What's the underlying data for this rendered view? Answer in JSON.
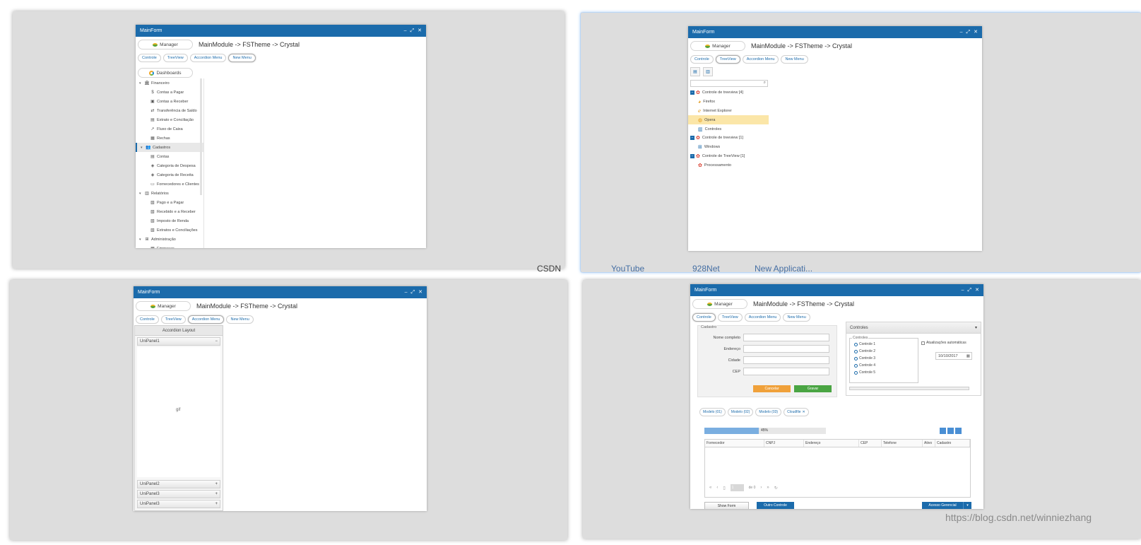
{
  "common": {
    "window_title": "MainForm",
    "manager_label": "Manager",
    "path": "MainModule -> FSTheme -> Crystal",
    "tabs": [
      "Controle",
      "TreeView",
      "Accordion Menu",
      "New Menu"
    ],
    "titlebar_icons": [
      "‒",
      "⤢",
      "✕"
    ]
  },
  "pane1": {
    "dashboards_label": "Dashboards",
    "tree": [
      {
        "level": 0,
        "label": "Financeiro",
        "icon": "bank-icon",
        "glyph": "🏛"
      },
      {
        "level": 1,
        "label": "Contas a Pagar",
        "icon": "dollar-icon",
        "glyph": "$"
      },
      {
        "level": 1,
        "label": "Contas a Receber",
        "icon": "money-icon",
        "glyph": "▣"
      },
      {
        "level": 1,
        "label": "Transferência de Saldo",
        "icon": "transfer-icon",
        "glyph": "⇄"
      },
      {
        "level": 1,
        "label": "Extrato e Conciliação",
        "icon": "card-icon",
        "glyph": "▤"
      },
      {
        "level": 1,
        "label": "Fluxo de Caixa",
        "icon": "chart-line-icon",
        "glyph": "↗"
      },
      {
        "level": 1,
        "label": "Rechas",
        "icon": "file-icon",
        "glyph": "▦"
      },
      {
        "level": 0,
        "label": "Cadastros",
        "icon": "users-icon",
        "glyph": "👥",
        "highlight": true
      },
      {
        "level": 1,
        "label": "Contas",
        "icon": "card-icon",
        "glyph": "▤"
      },
      {
        "level": 1,
        "label": "Categoria de Despesa",
        "icon": "tag-icon",
        "glyph": "◈"
      },
      {
        "level": 1,
        "label": "Categoria de Receita",
        "icon": "tag-icon",
        "glyph": "◈"
      },
      {
        "level": 1,
        "label": "Fornecedores e Clientes",
        "icon": "id-card-icon",
        "glyph": "▭"
      },
      {
        "level": 0,
        "label": "Relatórios",
        "icon": "report-icon",
        "glyph": "▥"
      },
      {
        "level": 1,
        "label": "Pago e a Pagar",
        "icon": "doc-icon",
        "glyph": "▧"
      },
      {
        "level": 1,
        "label": "Recebido e a Receber",
        "icon": "doc-icon",
        "glyph": "▧"
      },
      {
        "level": 1,
        "label": "Imposto de Renda",
        "icon": "doc-icon",
        "glyph": "▧"
      },
      {
        "level": 1,
        "label": "Extratos e Conciliações",
        "icon": "doc-icon",
        "glyph": "▧"
      },
      {
        "level": 0,
        "label": "Administração",
        "icon": "sitemap-icon",
        "glyph": "⊞"
      },
      {
        "level": 1,
        "label": "Empresas",
        "icon": "building-icon",
        "glyph": "▦"
      }
    ]
  },
  "pane2": {
    "selected_tab": 1,
    "tree": [
      {
        "level": 0,
        "label": "Controle de treeview [4]",
        "icon": "red-group-icon"
      },
      {
        "level": 1,
        "label": "Firefox",
        "icon": "firefox-icon"
      },
      {
        "level": 1,
        "label": "Internet Explorer",
        "icon": "ie-icon"
      },
      {
        "level": 1,
        "label": "Opera",
        "icon": "opera-icon",
        "selected": true
      },
      {
        "level": 1,
        "label": "Controles",
        "icon": "controls-icon"
      },
      {
        "level": 0,
        "label": "Controle de treeview [1]",
        "icon": "red-group-icon"
      },
      {
        "level": 1,
        "label": "Windows",
        "icon": "windows-icon"
      },
      {
        "level": 0,
        "label": "Controle de TreeView [1]",
        "icon": "red-group-icon"
      },
      {
        "level": 1,
        "label": "Processamento",
        "icon": "gear-icon"
      }
    ]
  },
  "pane3": {
    "selected_tab": 2,
    "accordion_title": "Accordion Layout",
    "panels": [
      "UniPanel1",
      "UniPanel2",
      "UniPanel3",
      "UniPanel3"
    ],
    "body_text": "gif"
  },
  "pane4": {
    "selected_tab": 0,
    "cadastro_legend": "Cadastro",
    "fields": [
      "Nome completo",
      "Endereço",
      "Cidade",
      "CEP"
    ],
    "btn_cancel": "Cancelar",
    "btn_save": "Gravar",
    "controles_title": "Controles",
    "controles_legend": "Controles",
    "radios": [
      "Controle 1",
      "Controle 2",
      "Controle 3",
      "Controle 4",
      "Controle 5"
    ],
    "checkbox_label": "Atualizações automáticas",
    "date_value": "10/10/2017",
    "sub_tabs": [
      "Modelo (01)",
      "Modelo (02)",
      "Modelo (03)",
      "Cloudfile"
    ],
    "progress_percent": 45,
    "progress_label": "45%",
    "grid_columns": [
      "Fornecedor",
      "CNPJ",
      "Endereço",
      "CEP",
      "Telefone",
      "Ativo",
      "Cadastro"
    ],
    "pager_page": "1",
    "pager_of": "de 0",
    "btn_show_form": "Show Form",
    "btn_outro": "Outro Controle",
    "btn_acesso": "Acesso Gerencial"
  },
  "bookmarks": [
    "CSDN",
    "YouTube",
    "928Net",
    "New Applicati..."
  ],
  "watermark": "https://blog.csdn.net/winniezhang",
  "colors": {
    "titlebar": "#1b6bab",
    "accent": "#1b6bab",
    "orange": "#f0a13a",
    "green": "#4aa543",
    "selected_row": "#fbe6a8"
  }
}
